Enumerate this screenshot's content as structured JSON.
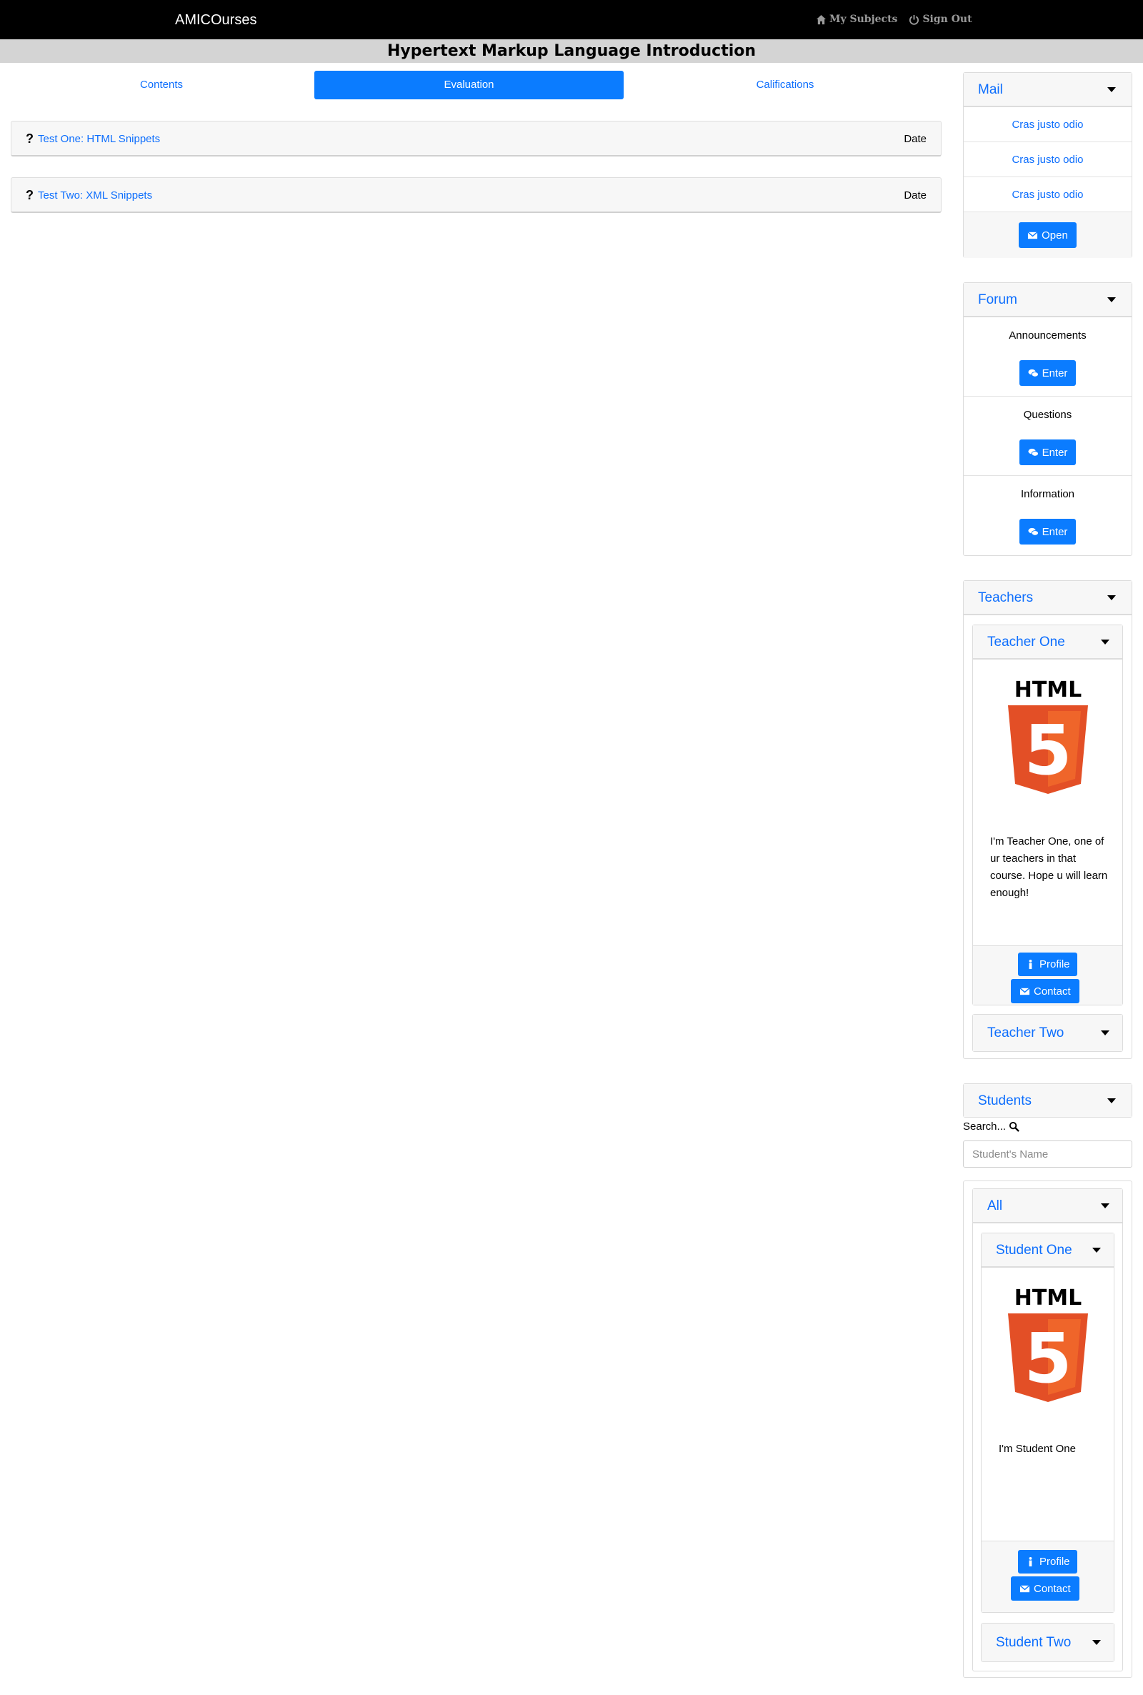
{
  "navbar": {
    "brand": "AMICOurses",
    "links": [
      {
        "label": "My Subjects",
        "icon": "home-icon"
      },
      {
        "label": "Sign Out",
        "icon": "power-icon"
      }
    ]
  },
  "page_title": "Hypertext Markup Language Introduction",
  "tabs": [
    {
      "label": "Contents",
      "active": false
    },
    {
      "label": "Evaluation",
      "active": true
    },
    {
      "label": "Califications",
      "active": false
    }
  ],
  "tests": [
    {
      "icon": "?",
      "title": "Test One: HTML Snippets",
      "date": "Date"
    },
    {
      "icon": "?",
      "title": "Test Two: XML Snippets",
      "date": "Date"
    }
  ],
  "mail": {
    "title": "Mail",
    "items": [
      "Cras justo odio",
      "Cras justo odio",
      "Cras justo odio"
    ],
    "open_label": "Open"
  },
  "forum": {
    "title": "Forum",
    "items": [
      {
        "label": "Announcements",
        "button": "Enter"
      },
      {
        "label": "Questions",
        "button": "Enter"
      },
      {
        "label": "Information",
        "button": "Enter"
      }
    ]
  },
  "teachers": {
    "title": "Teachers",
    "teacher_one": {
      "name": "Teacher One",
      "bio": "I'm Teacher One, one of ur teachers in that course. Hope u will learn enough!",
      "profile_label": "Profile",
      "contact_label": "Contact"
    },
    "teacher_two": {
      "name": "Teacher Two"
    }
  },
  "students": {
    "title": "Students",
    "search_label": "Search...",
    "search_placeholder": "Student's Name",
    "group_title": "All",
    "student_one": {
      "name": "Student One",
      "bio": "I'm Student One",
      "profile_label": "Profile",
      "contact_label": "Contact"
    },
    "student_two": {
      "name": "Student Two"
    }
  },
  "logo_text": "HTML",
  "logo_digit": "5",
  "colors": {
    "accent": "#0b7cff",
    "link": "#0d6efd",
    "navbar": "#000000",
    "html5_orange": "#e34f26"
  }
}
